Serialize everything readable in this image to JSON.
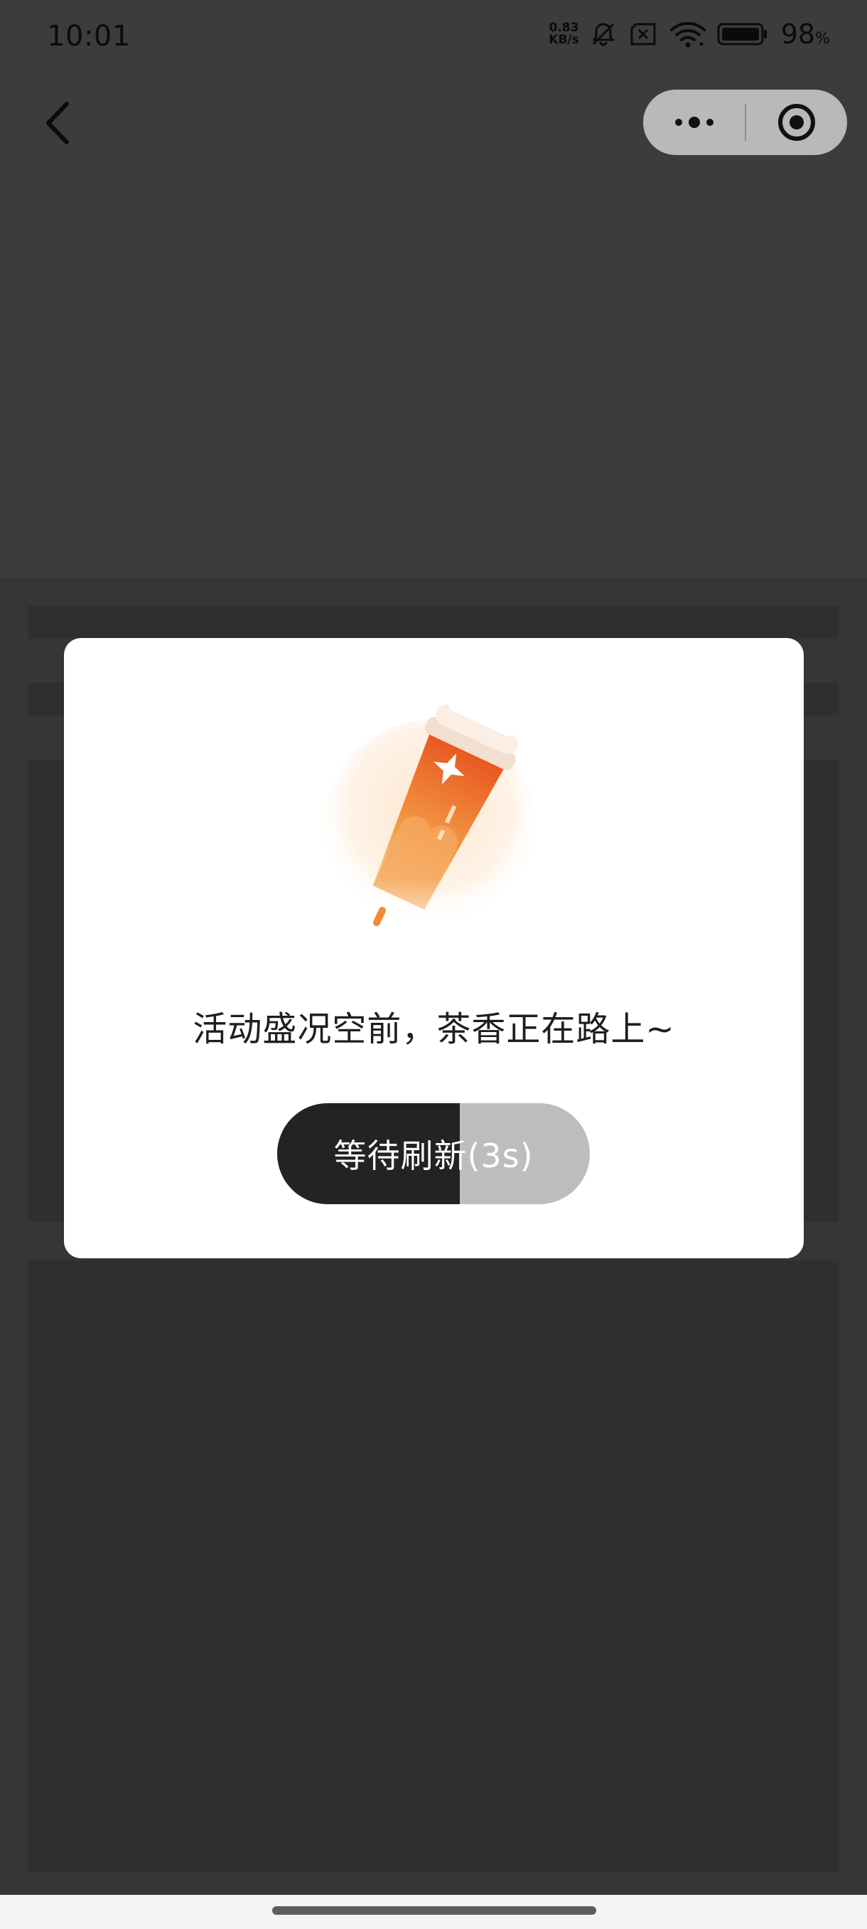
{
  "status_bar": {
    "time": "10:01",
    "net_speed_value": "0.83",
    "net_speed_unit": "KB/s",
    "battery_percent": "98",
    "battery_unit": "%",
    "icons": [
      "net-speed-icon",
      "bell-muted-icon",
      "no-sim-icon",
      "wifi-icon",
      "battery-icon"
    ]
  },
  "nav": {
    "back_icon": "chevron-left-icon",
    "capsule": {
      "more_icon": "more-dots-icon",
      "close_icon": "target-circle-icon"
    }
  },
  "modal": {
    "illustration": "tea-cup-illustration",
    "message": "活动盛况空前，茶香正在路上~",
    "refresh_button": {
      "label": "等待刷新(3s)",
      "progress_fraction": 0.585
    }
  },
  "colors": {
    "overlay": "#3a3a3a",
    "modal_bg": "#ffffff",
    "button_fill": "#232323",
    "button_track": "#bdbdbd",
    "accent_orange": "#f07a2c"
  }
}
